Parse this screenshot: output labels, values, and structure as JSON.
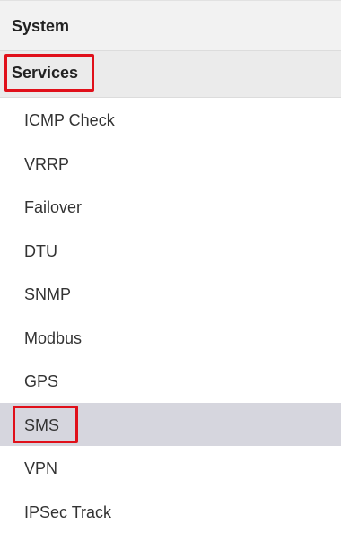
{
  "sidebar": {
    "section_system": "System",
    "section_services": "Services",
    "items": [
      {
        "label": "ICMP Check"
      },
      {
        "label": "VRRP"
      },
      {
        "label": "Failover"
      },
      {
        "label": "DTU"
      },
      {
        "label": "SNMP"
      },
      {
        "label": "Modbus"
      },
      {
        "label": "GPS"
      },
      {
        "label": "SMS",
        "active": true
      },
      {
        "label": "VPN"
      },
      {
        "label": "IPSec Track"
      }
    ]
  },
  "colors": {
    "highlight_border": "#e0101a",
    "active_item_bg": "#d6d6de",
    "header_bg": "#f2f2f2"
  }
}
